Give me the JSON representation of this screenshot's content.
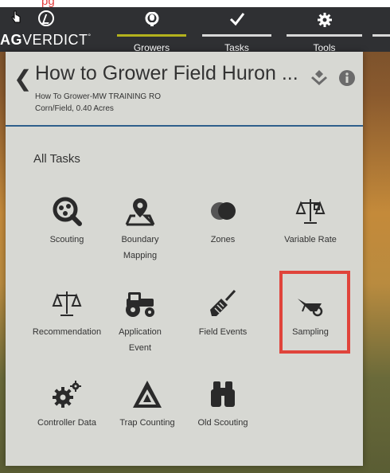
{
  "top_fragment": "pg",
  "brand": {
    "name_bold": "AG",
    "name_rest": "VERDICT",
    "trademark": "°"
  },
  "nav": {
    "tabs": [
      {
        "label": "Growers",
        "icon": "person-icon",
        "active": true
      },
      {
        "label": "Tasks",
        "icon": "check-icon",
        "active": false
      },
      {
        "label": "Tools",
        "icon": "gear-icon",
        "active": false
      }
    ]
  },
  "field": {
    "title": "How to Grower Field Huron ...",
    "subtitle_line1": "How To Grower-MW TRAINING RO",
    "subtitle_line2": "Corn/Field, 0.40 Acres"
  },
  "section_title": "All Tasks",
  "tasks": [
    {
      "label": "Scouting",
      "icon": "scouting-icon"
    },
    {
      "label": "Boundary Mapping",
      "label_l1": "Boundary",
      "label_l2": "Mapping",
      "icon": "map-pin-icon"
    },
    {
      "label": "Zones",
      "icon": "zones-icon"
    },
    {
      "label": "Variable Rate",
      "icon": "scale-icon"
    },
    {
      "label": "Recommendation",
      "icon": "balance-icon"
    },
    {
      "label": "Application Event",
      "label_l1": "Application",
      "label_l2": "Event",
      "icon": "tractor-icon"
    },
    {
      "label": "Field Events",
      "icon": "shovel-icon"
    },
    {
      "label": "Sampling",
      "icon": "wheelbarrow-icon"
    },
    {
      "label": "Controller Data",
      "icon": "gears-icon"
    },
    {
      "label": "Trap Counting",
      "icon": "trap-icon"
    },
    {
      "label": "Old Scouting",
      "icon": "binoculars-icon"
    }
  ],
  "colors": {
    "accent": "#b4b21d",
    "highlight": "#e0443b",
    "appbar": "#2f3033",
    "panel": "#d7d8d3"
  }
}
